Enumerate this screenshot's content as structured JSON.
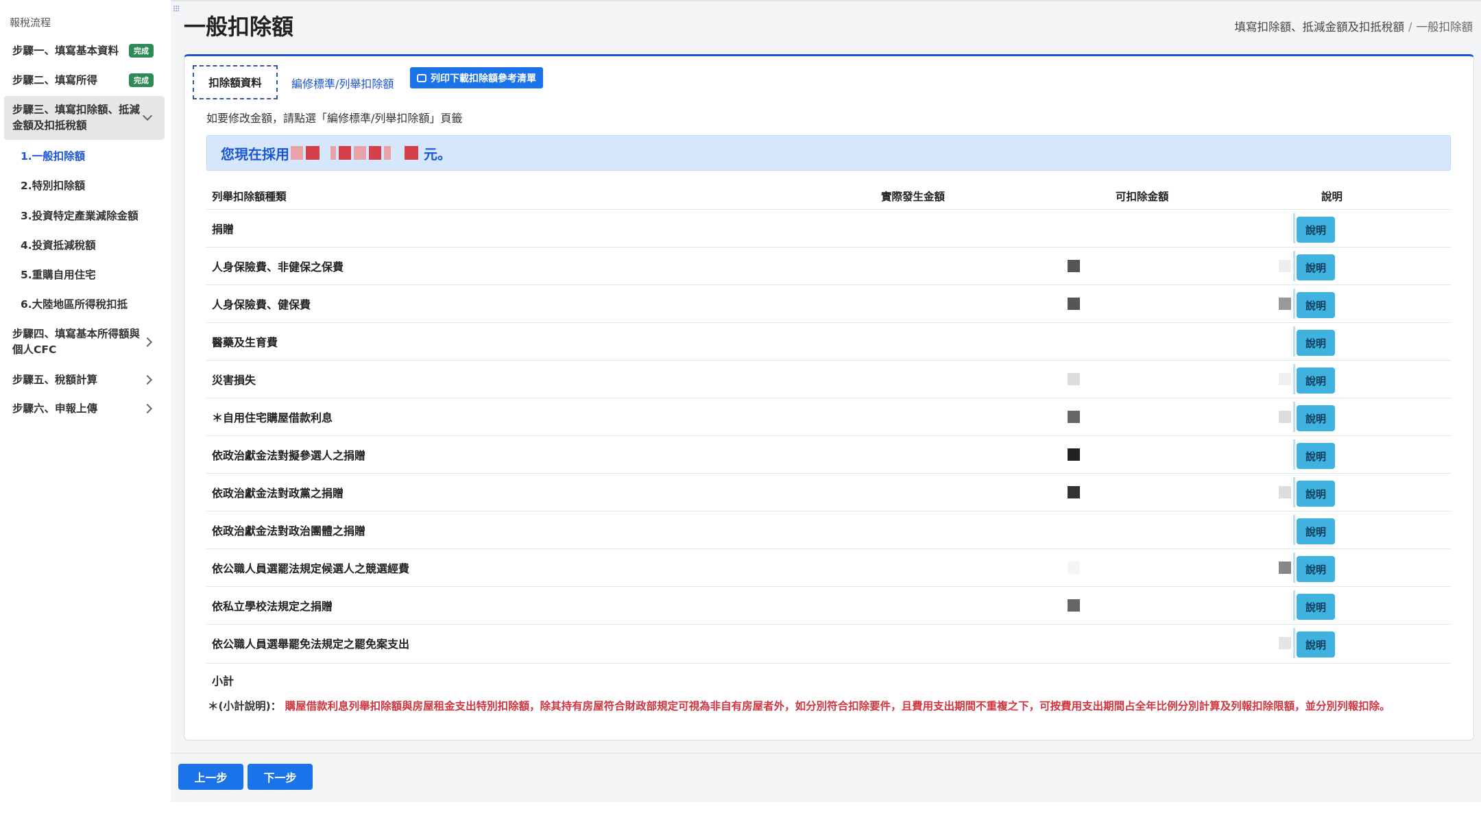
{
  "sidebar": {
    "title": "報稅流程",
    "steps": [
      {
        "label": "步驟一、填寫基本資料",
        "badge": "完成"
      },
      {
        "label": "步驟二、填寫所得",
        "badge": "完成"
      },
      {
        "label": "步驟三、填寫扣除額、抵減金額及扣抵稅額"
      },
      {
        "label": "步驟四、填寫基本所得額與個人CFC"
      },
      {
        "label": "步驟五、稅額計算"
      },
      {
        "label": "步驟六、申報上傳"
      }
    ],
    "sub_items": [
      "1.一般扣除額",
      "2.特別扣除額",
      "3.投資特定產業減除金額",
      "4.投資抵減稅額",
      "5.重購自用住宅",
      "6.大陸地區所得稅扣抵"
    ]
  },
  "page": {
    "title": "一般扣除額",
    "breadcrumb": [
      "填寫扣除額、抵減金額及扣抵稅額",
      "一般扣除額"
    ]
  },
  "tabs": {
    "active": "扣除額資料",
    "other": "編修標準/列舉扣除額",
    "print_button": "列印下載扣除額參考清單"
  },
  "hint": "如要修改金額，請點選「編修標準/列舉扣除額」頁籤",
  "banner": {
    "prefix": "您現在採用",
    "suffix": "元。"
  },
  "table": {
    "headers": [
      "列舉扣除額種類",
      "實際發生金額",
      "可扣除金額",
      "說明"
    ],
    "explain_label": "說明",
    "rows": [
      "捐贈",
      "人身保險費、非健保之保費",
      "人身保險費、健保費",
      "醫藥及生育費",
      "災害損失",
      "＊自用住宅購屋借款利息",
      "依政治獻金法對擬參選人之捐贈",
      "依政治獻金法對政黨之捐贈",
      "依政治獻金法對政治團體之捐贈",
      "依公職人員選罷法規定候選人之競選經費",
      "依私立學校法規定之捐贈",
      "依公職人員選舉罷免法規定之罷免案支出"
    ],
    "subtotal": "小計"
  },
  "note": {
    "label": "＊(小計說明)：",
    "text": "購屋借款利息列舉扣除額與房屋租金支出特別扣除額，除其持有房屋符合財政部規定可視為非自有房屋者外，如分別符合扣除要件，且費用支出期間不重複之下，可按費用支出期間占全年比例分別計算及列報扣除限額，並分別列報扣除。"
  },
  "footer": {
    "prev": "上一步",
    "next": "下一步"
  }
}
